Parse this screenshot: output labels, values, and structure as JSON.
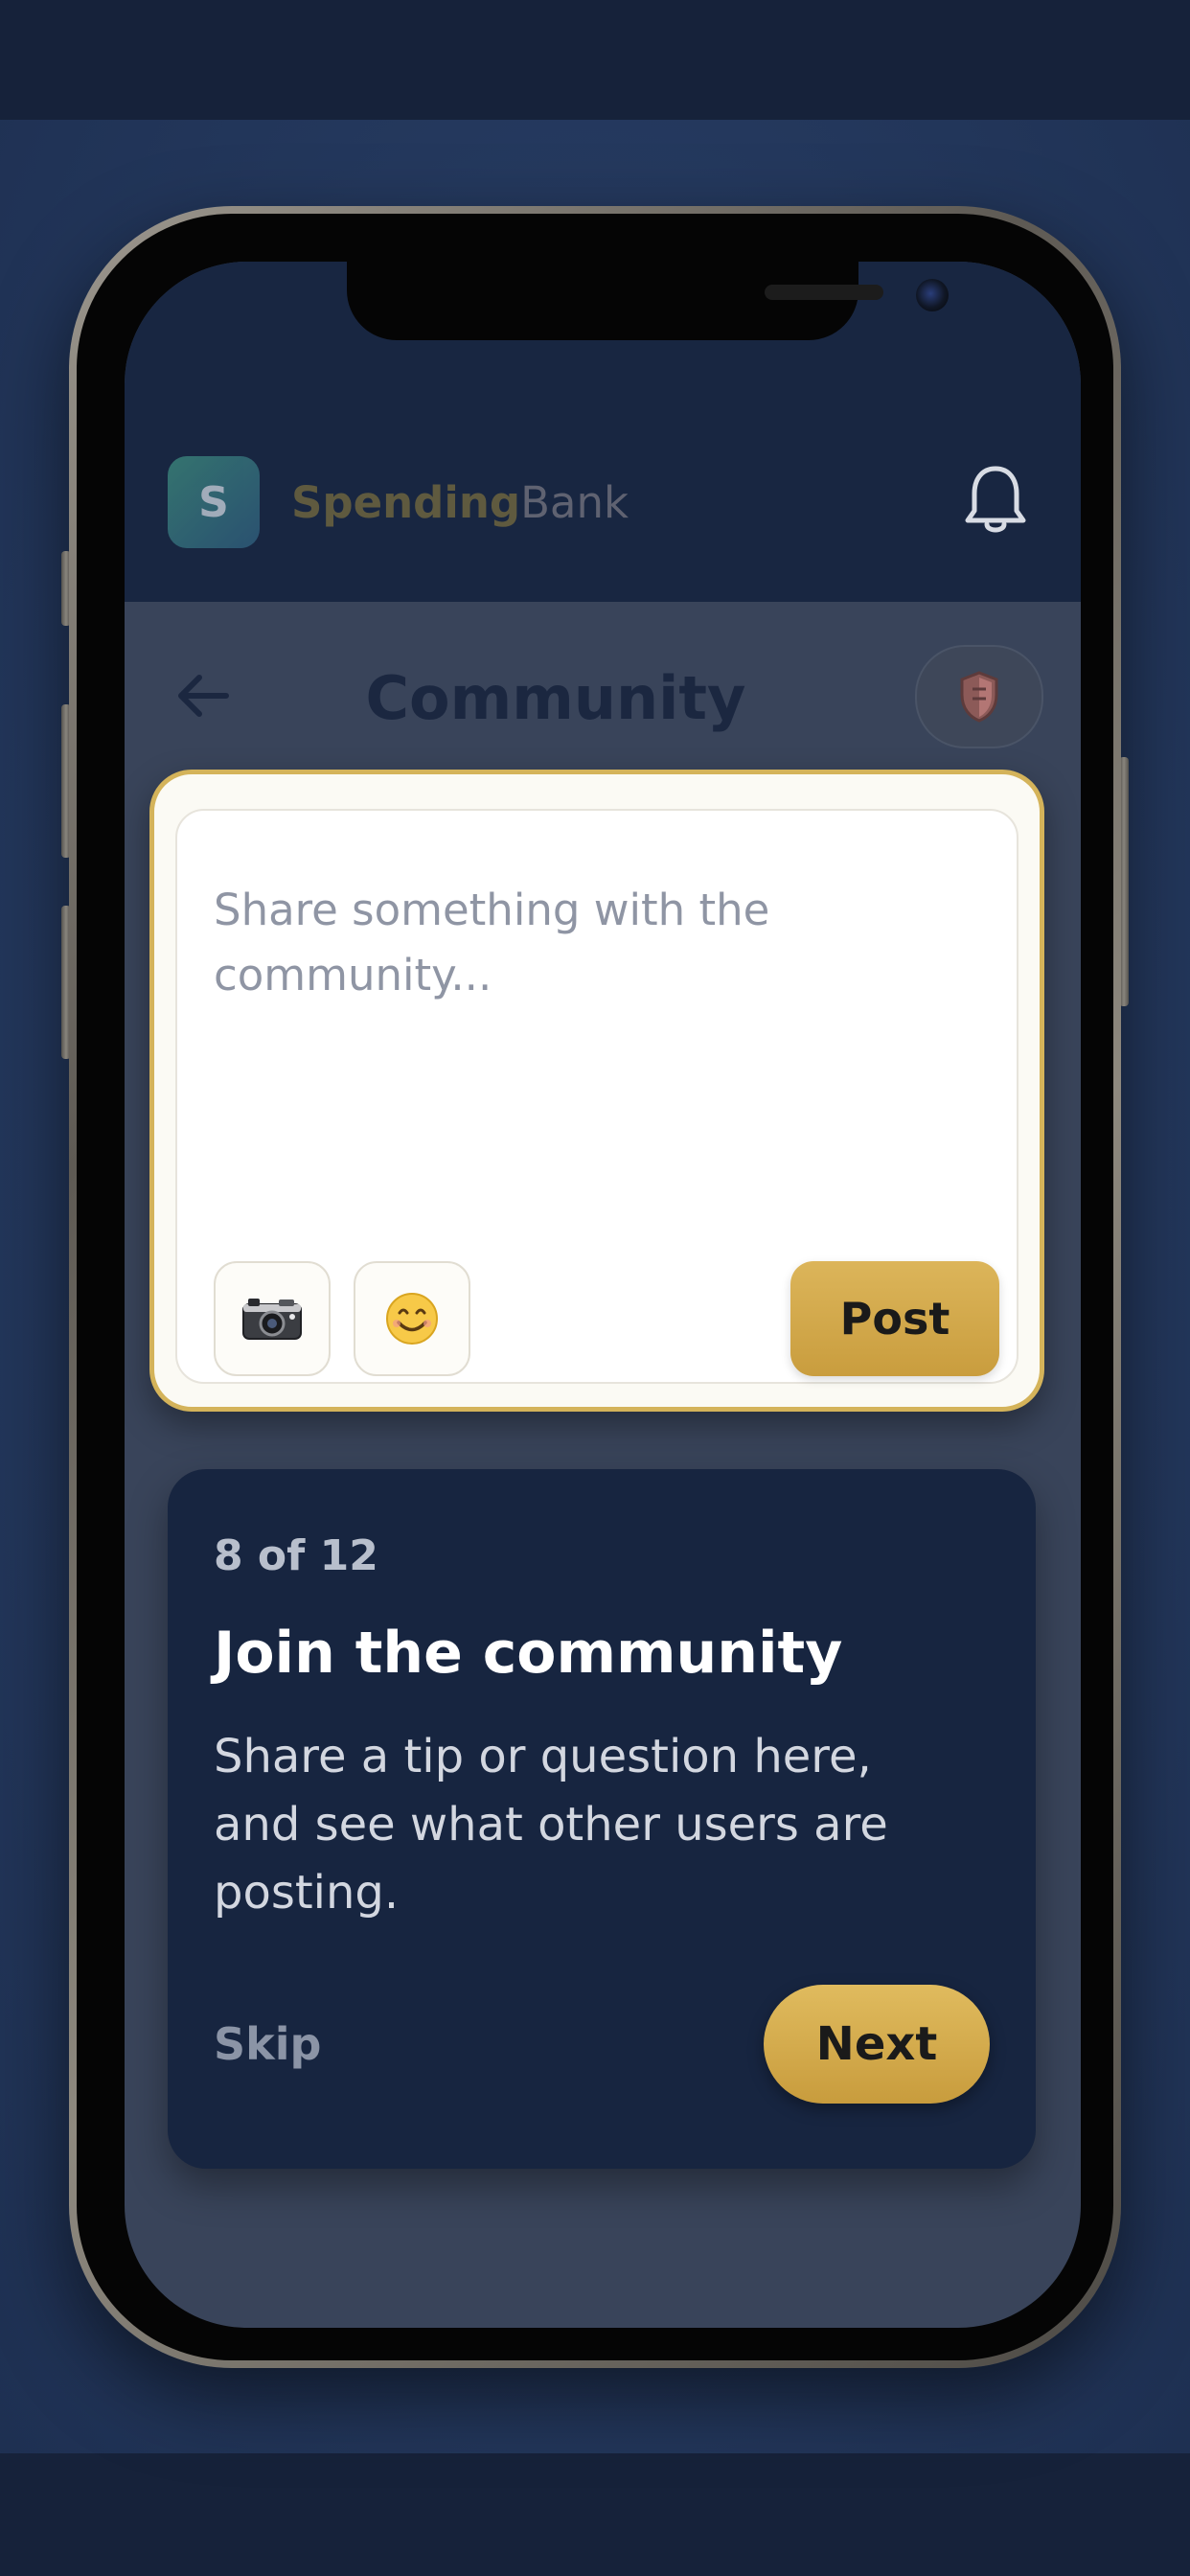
{
  "app": {
    "brand_primary": "Spending",
    "brand_secondary": "Bank",
    "logo_letter": "S",
    "accent_color": "#d4b35a",
    "header_color": "#182641"
  },
  "page": {
    "title": "Community"
  },
  "composer": {
    "placeholder": "Share something with the community...",
    "post_label": "Post",
    "attachments": [
      "camera-icon",
      "emoji-icon"
    ]
  },
  "onboarding": {
    "step": "8 of 12",
    "title": "Join the community",
    "body": "Share a tip or question here, and see what other users are posting.",
    "skip_label": "Skip",
    "next_label": "Next"
  },
  "icons": {
    "notifications": "bell-icon",
    "back": "back-arrow-icon",
    "badge": "shield-icon"
  }
}
